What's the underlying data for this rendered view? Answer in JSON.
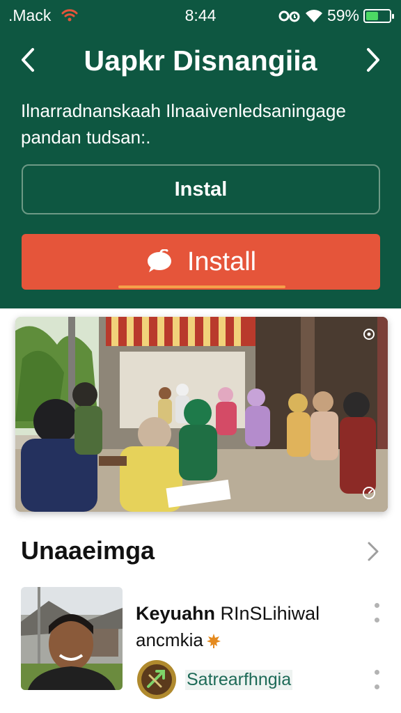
{
  "status_bar": {
    "carrier": ".Mack",
    "time": "8:44",
    "battery_text": "59%",
    "battery_level": 0.59,
    "colors": {
      "wifi_carrier": "#e5553a",
      "battery_fill": "#4cd964"
    }
  },
  "header": {
    "title": "Uapkr Disnangiia",
    "back_icon": "chevron-left-icon",
    "forward_icon": "chevron-right-icon",
    "background": "#0e5741"
  },
  "description": {
    "line1": "Ilnarradnanskaah Ilnaaivenledsaningage",
    "line2": "pandan tudsan:."
  },
  "buttons": {
    "outline_label": "Instal",
    "primary_label": "Install",
    "primary_icon": "speech-bubble-icon",
    "primary_color": "#e5553a"
  },
  "hero": {
    "top_icon": "info-icon",
    "bottom_icon": "timer-icon"
  },
  "section": {
    "title": "Unaaeimga",
    "chevron_icon": "chevron-right-icon"
  },
  "item": {
    "name_bold": "Keyuahn",
    "name_rest": " RInSLihiwal",
    "subtitle": "ancmkia",
    "subtitle_icon": "maple-leaf-icon",
    "badge_label": "Satrearfhngia",
    "badge_icon": "arrow-emblem-icon"
  }
}
